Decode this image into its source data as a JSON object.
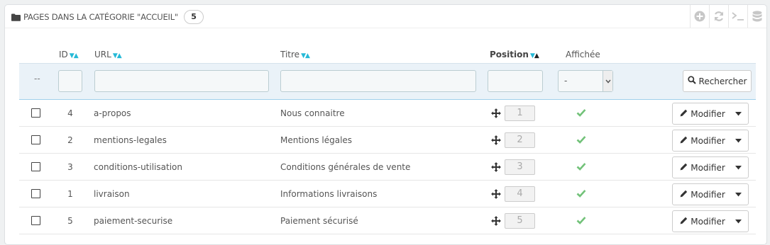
{
  "header": {
    "title": "PAGES DANS LA CATÉGORIE \"ACCUEIL\"",
    "count": "5",
    "icons": [
      "add-icon",
      "refresh-icon",
      "sql-terminal-icon",
      "database-icon"
    ]
  },
  "columns": {
    "id": "ID",
    "url": "URL",
    "title": "Titre",
    "position": "Position",
    "displayed": "Affichée"
  },
  "filters": {
    "id_value": "",
    "url_value": "",
    "title_value": "",
    "position_value": "",
    "displayed_selected": "-",
    "search_label": "Rechercher",
    "empty_marker": "--"
  },
  "rows": [
    {
      "id": "4",
      "url": "a-propos",
      "title": "Nous connaitre",
      "position": "1",
      "displayed": true,
      "edit_label": "Modifier"
    },
    {
      "id": "2",
      "url": "mentions-legales",
      "title": "Mentions légales",
      "position": "2",
      "displayed": true,
      "edit_label": "Modifier"
    },
    {
      "id": "3",
      "url": "conditions-utilisation",
      "title": "Conditions générales de vente",
      "position": "3",
      "displayed": true,
      "edit_label": "Modifier"
    },
    {
      "id": "1",
      "url": "livraison",
      "title": "Informations livraisons",
      "position": "4",
      "displayed": true,
      "edit_label": "Modifier"
    },
    {
      "id": "5",
      "url": "paiement-securise",
      "title": "Paiement sécurisé",
      "position": "5",
      "displayed": true,
      "edit_label": "Modifier"
    }
  ],
  "colors": {
    "accent": "#25b9d7",
    "check": "#72c279",
    "filter_bg": "#eaf2f8"
  }
}
